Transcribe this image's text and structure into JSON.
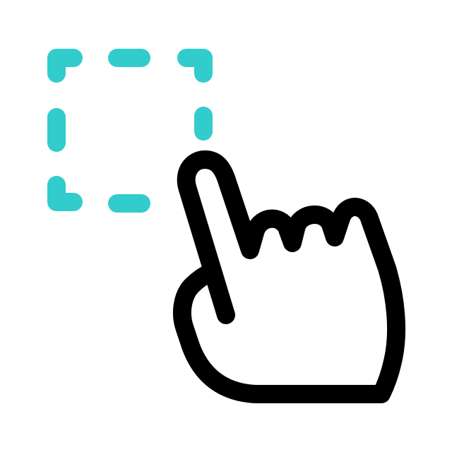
{
  "icon": {
    "name": "select-area-icon",
    "parts": [
      "dashed-selection-icon",
      "pointing-hand-icon"
    ]
  },
  "colors": {
    "background": "#ffffff",
    "selection": "#33cccc",
    "hand": "#000000"
  }
}
